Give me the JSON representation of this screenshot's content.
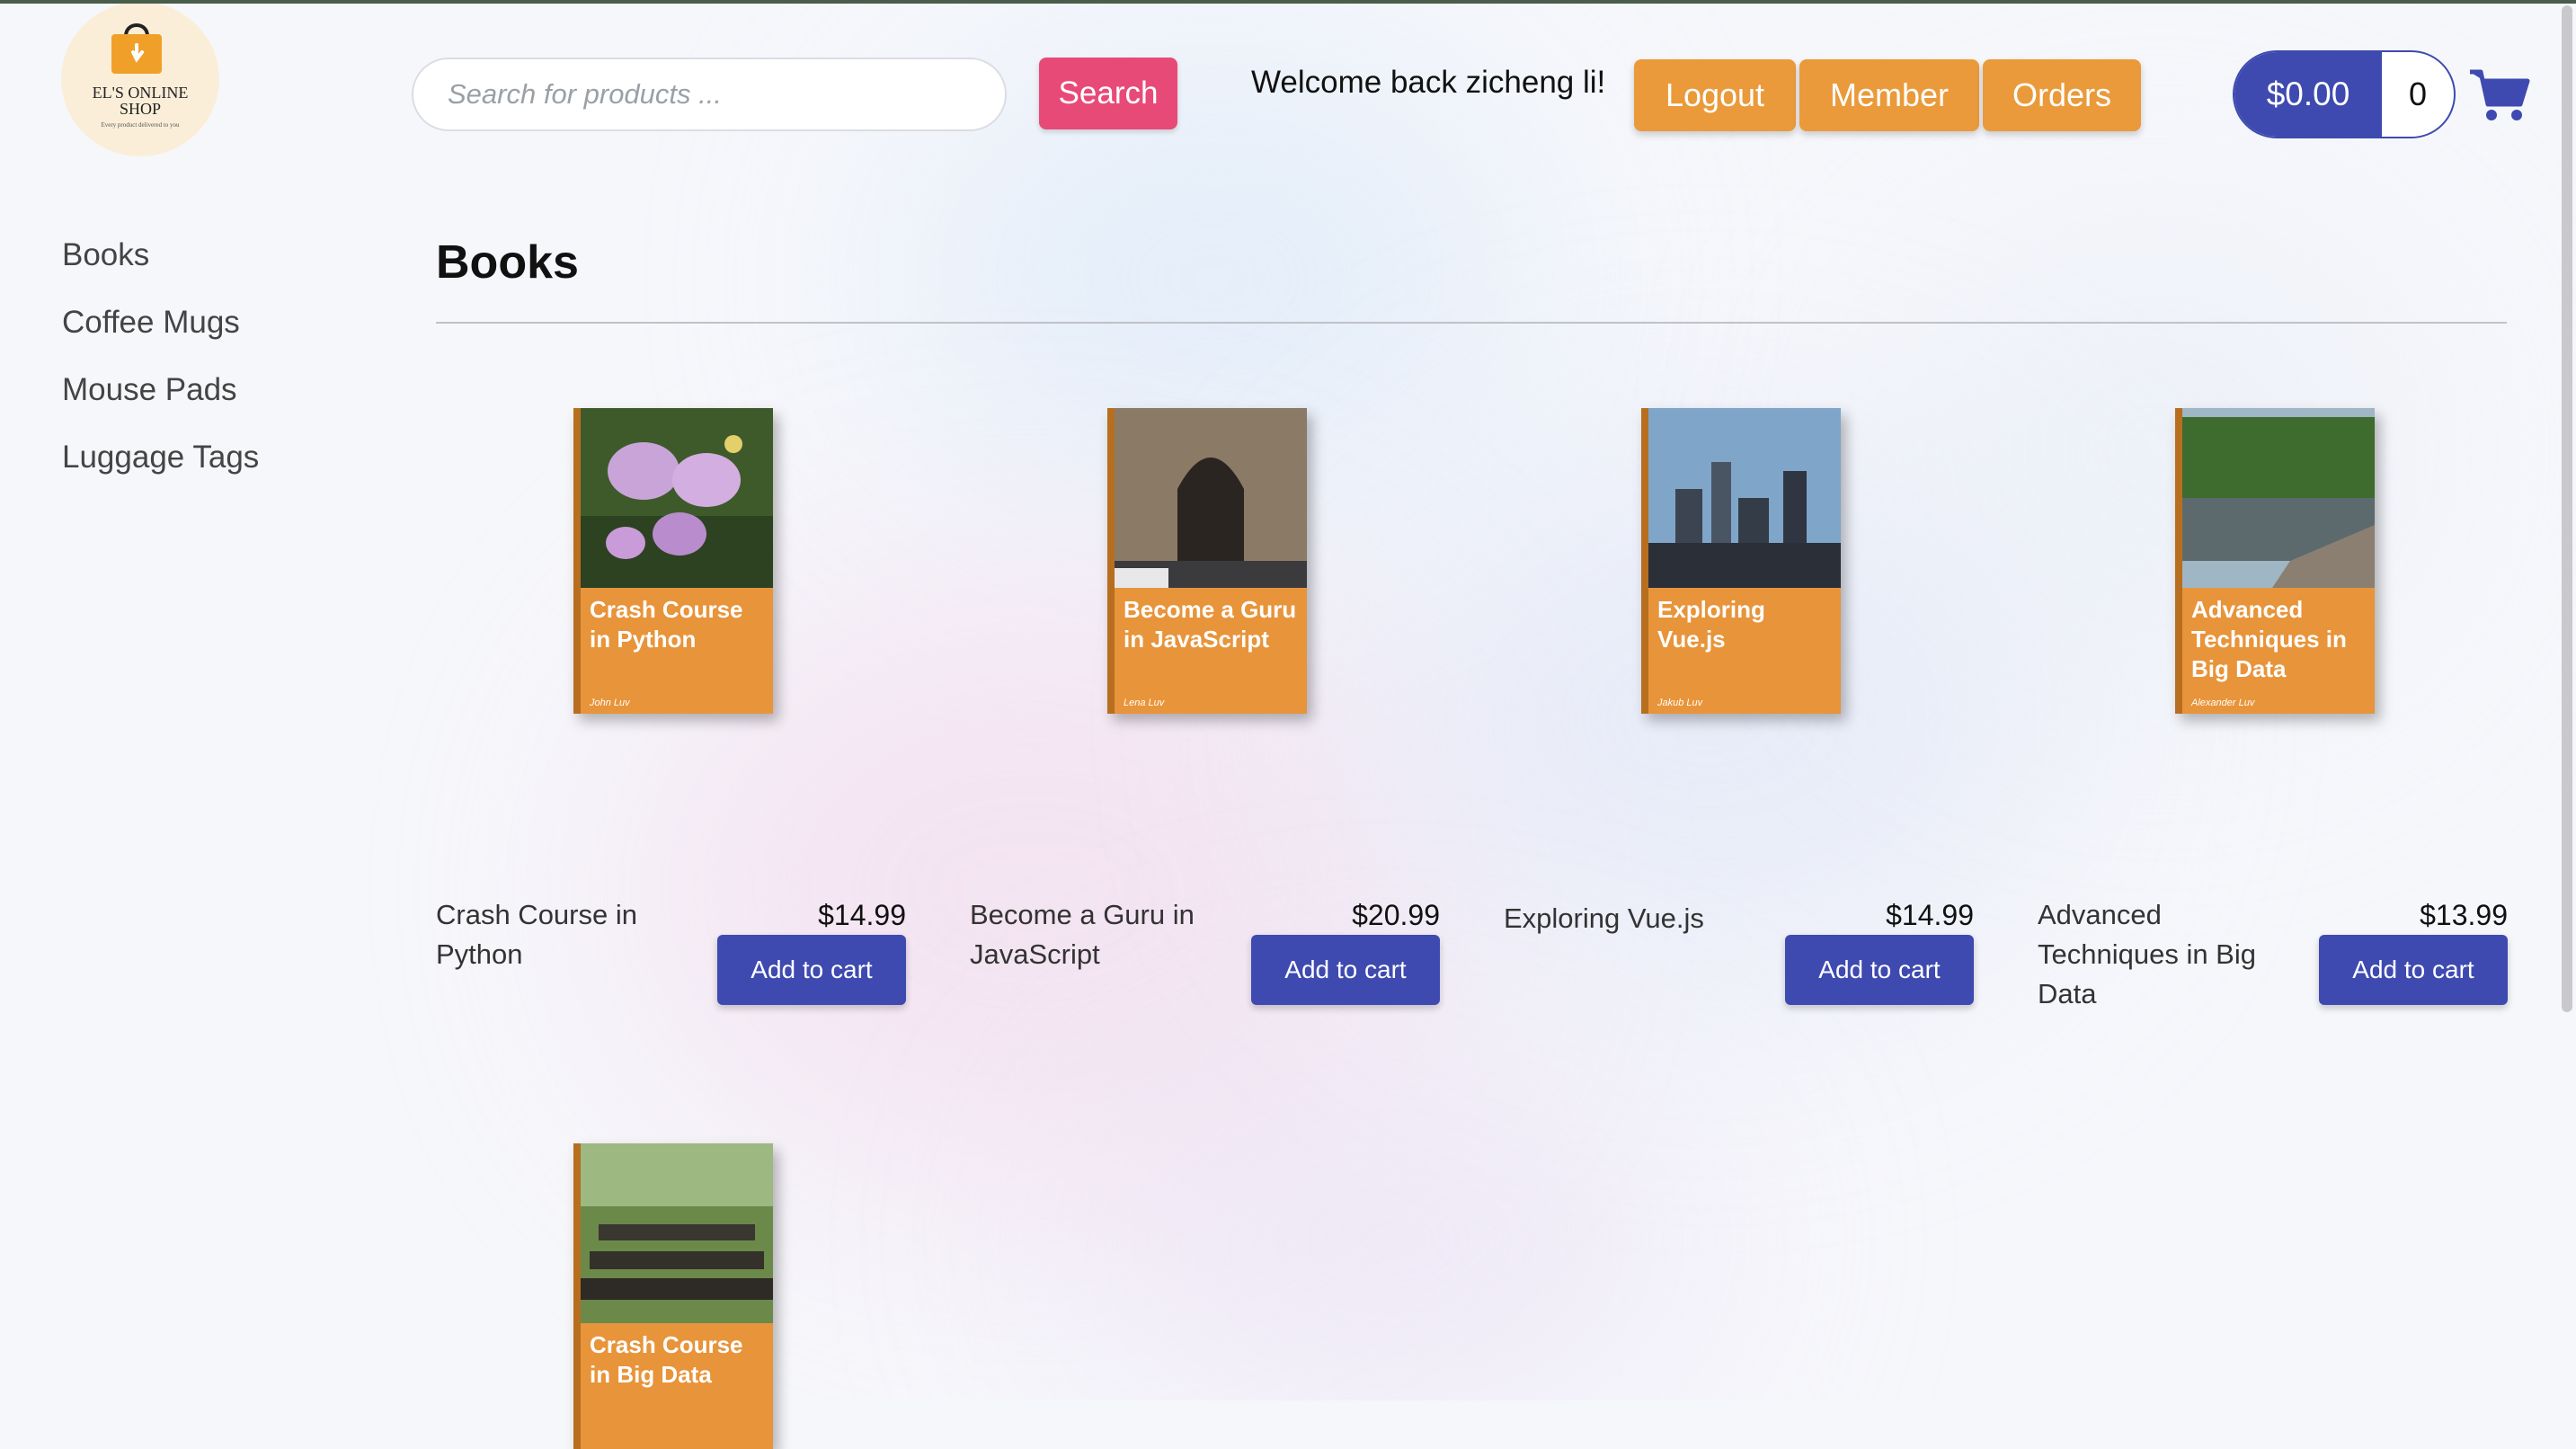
{
  "brand": {
    "line1": "EL'S ONLINE",
    "line2": "SHOP",
    "tagline": "Every product delivered to you"
  },
  "header": {
    "search_placeholder": "Search for products ...",
    "search_label": "Search",
    "welcome": "Welcome back zicheng li!",
    "logout_label": "Logout",
    "member_label": "Member",
    "orders_label": "Orders",
    "cart_total": "$0.00",
    "cart_count": "0",
    "cart_icon": "shopping-cart-icon"
  },
  "sidebar": {
    "items": [
      {
        "label": "Books"
      },
      {
        "label": "Coffee Mugs"
      },
      {
        "label": "Mouse Pads"
      },
      {
        "label": "Luggage Tags"
      }
    ]
  },
  "main": {
    "title": "Books",
    "products": [
      {
        "name": "Crash Course in Python",
        "price": "$14.99",
        "add_label": "Add to cart",
        "cover_title": "Crash Course in Python",
        "cover_author": "John Luv"
      },
      {
        "name": "Become a Guru in JavaScript",
        "price": "$20.99",
        "add_label": "Add to cart",
        "cover_title": "Become a Guru in JavaScript",
        "cover_author": "Lena Luv"
      },
      {
        "name": "Exploring Vue.js",
        "price": "$14.99",
        "add_label": "Add to cart",
        "cover_title": "Exploring Vue.js",
        "cover_author": "Jakub Luv"
      },
      {
        "name": "Advanced Techniques in Big Data",
        "price": "$13.99",
        "add_label": "Add to cart",
        "cover_title": "Advanced Techniques in Big Data",
        "cover_author": "Alexander Luv"
      },
      {
        "cover_title": "Crash Course in Big Data"
      }
    ]
  },
  "colors": {
    "accent_orange": "#ea9a3a",
    "search_pink": "#e84a78",
    "primary_blue": "#3e4ab0"
  }
}
